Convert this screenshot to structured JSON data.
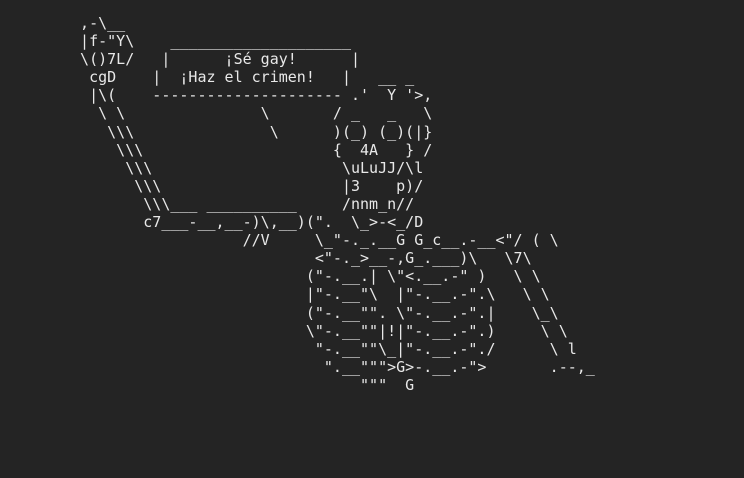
{
  "art": {
    "lines": [
      "  ,-\\__",
      "  |f-\"Y\\    ____________________",
      "  \\()7L/   |      ¡Sé gay!      |",
      "   cgD    |  ¡Haz el crimen!   |   __ _",
      "   |\\(    --------------------- .'  Y '>,",
      "    \\ \\               \\       / _   _   \\",
      "     \\\\\\               \\      )(_) (_)(|}",
      "      \\\\\\                     {  4A   } /",
      "       \\\\\\                     \\uLuJJ/\\l",
      "        \\\\\\                    |3    p)/",
      "         \\\\\\___ __________     /nnm_n//",
      "         c7___-__,__-)\\,__)(\".  \\_>-<_/D",
      "                    //V     \\_\"-._.__G G_c__.-__<\"/ ( \\",
      "                            <\"-._>__-,G_.___)\\   \\7\\",
      "                           (\"-.__.| \\\"<.__.-\" )   \\ \\",
      "                           |\"-.__\"\\  |\"-.__.-\".\\   \\ \\",
      "                           (\"-.__\"\". \\\"-.__.-\".|    \\_\\",
      "                           \\\"-.__\"\"|!|\"-.__.-\".)     \\ \\",
      "                            \"-.__\"\"\\_|\"-.__.-\"./      \\ l",
      "                             \".__\"\"\">G>-.__.-\">       .--,_",
      "                                 \"\"\"  G"
    ]
  }
}
